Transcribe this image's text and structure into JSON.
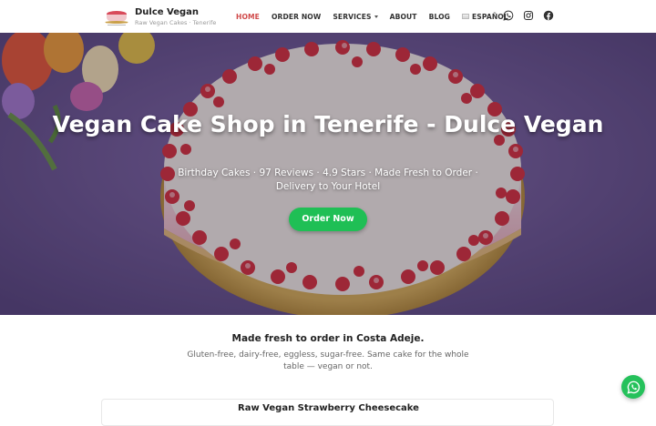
{
  "brand": {
    "name": "Dulce Vegan",
    "tagline": "Raw Vegan Cakes · Tenerife",
    "logo_icon": "cake-logo-icon"
  },
  "nav": {
    "items": [
      {
        "label": "HOME",
        "active": true
      },
      {
        "label": "ORDER NOW",
        "active": false
      },
      {
        "label": "SERVICES",
        "active": false,
        "has_dropdown": true
      },
      {
        "label": "ABOUT",
        "active": false
      },
      {
        "label": "BLOG",
        "active": false
      }
    ],
    "language": {
      "label": "ESPAÑOL",
      "icon": "flag-icon"
    },
    "social": [
      "whatsapp-icon",
      "instagram-icon",
      "facebook-icon"
    ],
    "active_color": "#d04a4a"
  },
  "hero": {
    "title": "Vegan Cake Shop in Tenerife - Dulce Vegan",
    "subtitle": "Birthday Cakes · 97 Reviews · 4.9 Stars · Made Fresh to Order · Delivery to Your Hotel",
    "cta_label": "Order Now",
    "cta_color": "#1fbf55"
  },
  "intro": {
    "lead": "Made fresh to order in Costa Adeje.",
    "text": "Gluten-free, dairy-free, eggless, sugar-free. Same cake for the whole table — vegan or not."
  },
  "product_card": {
    "title": "Raw Vegan Strawberry Cheesecake"
  },
  "floating": {
    "icon": "whatsapp-icon",
    "color": "#25c15b"
  }
}
